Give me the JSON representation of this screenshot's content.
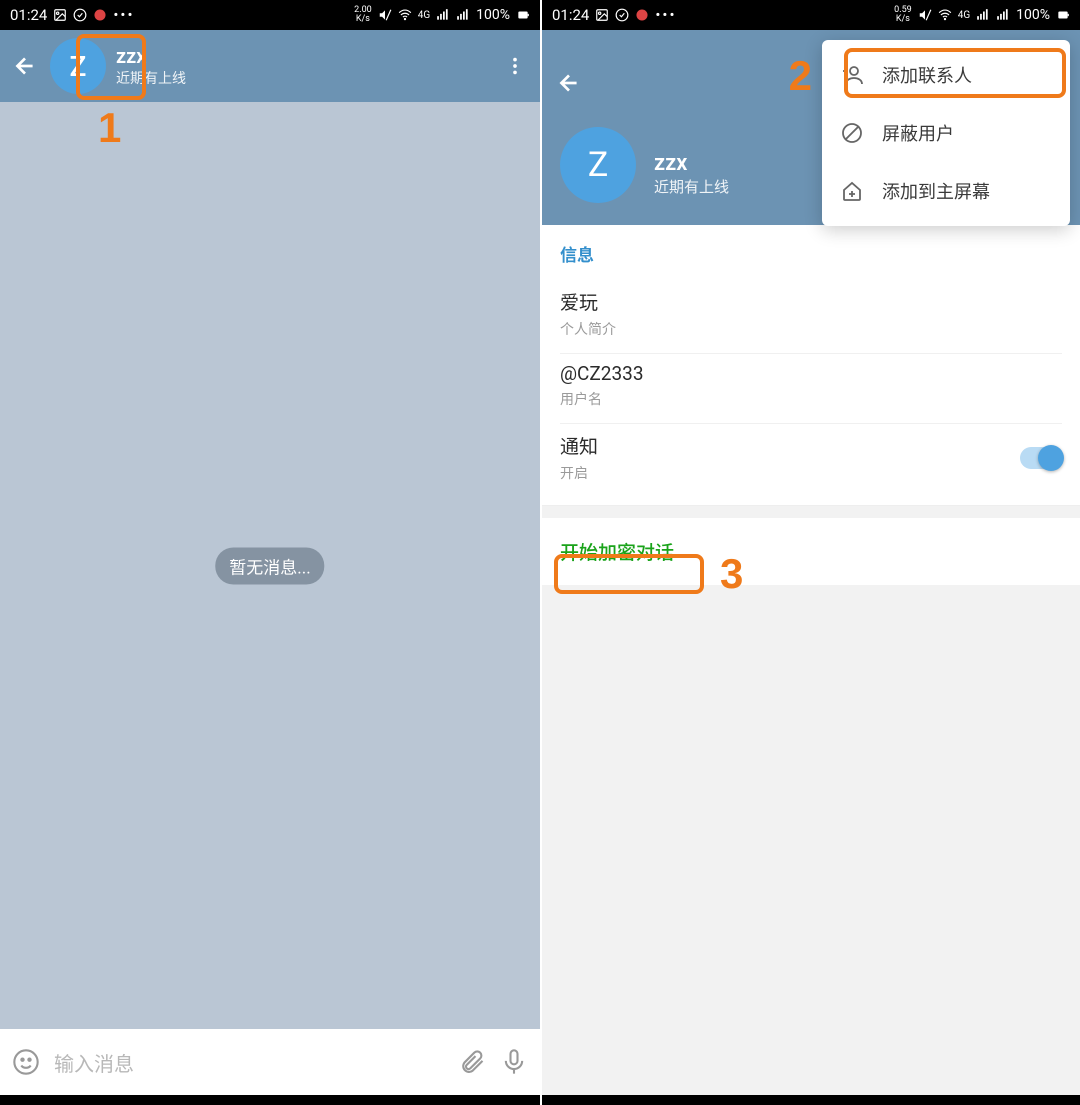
{
  "status": {
    "time": "01:24",
    "speed_left": "2.00",
    "speed_unit_left": "K/s",
    "speed_right": "0.59",
    "speed_unit_right": "K/s",
    "net": "4G",
    "battery": "100%"
  },
  "left": {
    "chat": {
      "avatar_letter": "Z",
      "title": "zzx",
      "subtitle": "近期有上线",
      "empty_text": "暂无消息...",
      "input_placeholder": "输入消息"
    }
  },
  "right": {
    "profile": {
      "avatar_letter": "Z",
      "name": "zzx",
      "status": "近期有上线",
      "section_title": "信息",
      "bio_value": "爱玩",
      "bio_label": "个人简介",
      "username_value": "@CZ2333",
      "username_label": "用户名",
      "notif_title": "通知",
      "notif_state": "开启",
      "secret_chat": "开始加密对话"
    },
    "menu": {
      "add_contact": "添加联系人",
      "block_user": "屏蔽用户",
      "add_home": "添加到主屏幕"
    }
  },
  "annotations": {
    "n1": "1",
    "n2": "2",
    "n3": "3"
  }
}
